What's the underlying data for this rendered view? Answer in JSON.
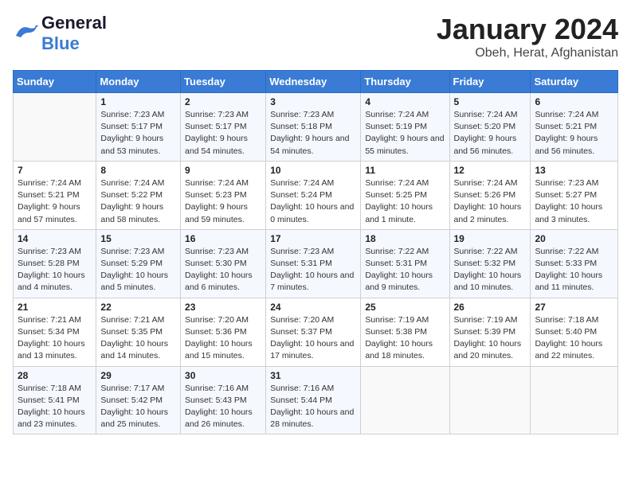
{
  "header": {
    "logo_general": "General",
    "logo_blue": "Blue",
    "title": "January 2024",
    "subtitle": "Obeh, Herat, Afghanistan"
  },
  "calendar": {
    "days_of_week": [
      "Sunday",
      "Monday",
      "Tuesday",
      "Wednesday",
      "Thursday",
      "Friday",
      "Saturday"
    ],
    "weeks": [
      [
        {
          "day": "",
          "sunrise": "",
          "sunset": "",
          "daylight": ""
        },
        {
          "day": "1",
          "sunrise": "Sunrise: 7:23 AM",
          "sunset": "Sunset: 5:17 PM",
          "daylight": "Daylight: 9 hours and 53 minutes."
        },
        {
          "day": "2",
          "sunrise": "Sunrise: 7:23 AM",
          "sunset": "Sunset: 5:17 PM",
          "daylight": "Daylight: 9 hours and 54 minutes."
        },
        {
          "day": "3",
          "sunrise": "Sunrise: 7:23 AM",
          "sunset": "Sunset: 5:18 PM",
          "daylight": "Daylight: 9 hours and 54 minutes."
        },
        {
          "day": "4",
          "sunrise": "Sunrise: 7:24 AM",
          "sunset": "Sunset: 5:19 PM",
          "daylight": "Daylight: 9 hours and 55 minutes."
        },
        {
          "day": "5",
          "sunrise": "Sunrise: 7:24 AM",
          "sunset": "Sunset: 5:20 PM",
          "daylight": "Daylight: 9 hours and 56 minutes."
        },
        {
          "day": "6",
          "sunrise": "Sunrise: 7:24 AM",
          "sunset": "Sunset: 5:21 PM",
          "daylight": "Daylight: 9 hours and 56 minutes."
        }
      ],
      [
        {
          "day": "7",
          "sunrise": "Sunrise: 7:24 AM",
          "sunset": "Sunset: 5:21 PM",
          "daylight": "Daylight: 9 hours and 57 minutes."
        },
        {
          "day": "8",
          "sunrise": "Sunrise: 7:24 AM",
          "sunset": "Sunset: 5:22 PM",
          "daylight": "Daylight: 9 hours and 58 minutes."
        },
        {
          "day": "9",
          "sunrise": "Sunrise: 7:24 AM",
          "sunset": "Sunset: 5:23 PM",
          "daylight": "Daylight: 9 hours and 59 minutes."
        },
        {
          "day": "10",
          "sunrise": "Sunrise: 7:24 AM",
          "sunset": "Sunset: 5:24 PM",
          "daylight": "Daylight: 10 hours and 0 minutes."
        },
        {
          "day": "11",
          "sunrise": "Sunrise: 7:24 AM",
          "sunset": "Sunset: 5:25 PM",
          "daylight": "Daylight: 10 hours and 1 minute."
        },
        {
          "day": "12",
          "sunrise": "Sunrise: 7:24 AM",
          "sunset": "Sunset: 5:26 PM",
          "daylight": "Daylight: 10 hours and 2 minutes."
        },
        {
          "day": "13",
          "sunrise": "Sunrise: 7:23 AM",
          "sunset": "Sunset: 5:27 PM",
          "daylight": "Daylight: 10 hours and 3 minutes."
        }
      ],
      [
        {
          "day": "14",
          "sunrise": "Sunrise: 7:23 AM",
          "sunset": "Sunset: 5:28 PM",
          "daylight": "Daylight: 10 hours and 4 minutes."
        },
        {
          "day": "15",
          "sunrise": "Sunrise: 7:23 AM",
          "sunset": "Sunset: 5:29 PM",
          "daylight": "Daylight: 10 hours and 5 minutes."
        },
        {
          "day": "16",
          "sunrise": "Sunrise: 7:23 AM",
          "sunset": "Sunset: 5:30 PM",
          "daylight": "Daylight: 10 hours and 6 minutes."
        },
        {
          "day": "17",
          "sunrise": "Sunrise: 7:23 AM",
          "sunset": "Sunset: 5:31 PM",
          "daylight": "Daylight: 10 hours and 7 minutes."
        },
        {
          "day": "18",
          "sunrise": "Sunrise: 7:22 AM",
          "sunset": "Sunset: 5:31 PM",
          "daylight": "Daylight: 10 hours and 9 minutes."
        },
        {
          "day": "19",
          "sunrise": "Sunrise: 7:22 AM",
          "sunset": "Sunset: 5:32 PM",
          "daylight": "Daylight: 10 hours and 10 minutes."
        },
        {
          "day": "20",
          "sunrise": "Sunrise: 7:22 AM",
          "sunset": "Sunset: 5:33 PM",
          "daylight": "Daylight: 10 hours and 11 minutes."
        }
      ],
      [
        {
          "day": "21",
          "sunrise": "Sunrise: 7:21 AM",
          "sunset": "Sunset: 5:34 PM",
          "daylight": "Daylight: 10 hours and 13 minutes."
        },
        {
          "day": "22",
          "sunrise": "Sunrise: 7:21 AM",
          "sunset": "Sunset: 5:35 PM",
          "daylight": "Daylight: 10 hours and 14 minutes."
        },
        {
          "day": "23",
          "sunrise": "Sunrise: 7:20 AM",
          "sunset": "Sunset: 5:36 PM",
          "daylight": "Daylight: 10 hours and 15 minutes."
        },
        {
          "day": "24",
          "sunrise": "Sunrise: 7:20 AM",
          "sunset": "Sunset: 5:37 PM",
          "daylight": "Daylight: 10 hours and 17 minutes."
        },
        {
          "day": "25",
          "sunrise": "Sunrise: 7:19 AM",
          "sunset": "Sunset: 5:38 PM",
          "daylight": "Daylight: 10 hours and 18 minutes."
        },
        {
          "day": "26",
          "sunrise": "Sunrise: 7:19 AM",
          "sunset": "Sunset: 5:39 PM",
          "daylight": "Daylight: 10 hours and 20 minutes."
        },
        {
          "day": "27",
          "sunrise": "Sunrise: 7:18 AM",
          "sunset": "Sunset: 5:40 PM",
          "daylight": "Daylight: 10 hours and 22 minutes."
        }
      ],
      [
        {
          "day": "28",
          "sunrise": "Sunrise: 7:18 AM",
          "sunset": "Sunset: 5:41 PM",
          "daylight": "Daylight: 10 hours and 23 minutes."
        },
        {
          "day": "29",
          "sunrise": "Sunrise: 7:17 AM",
          "sunset": "Sunset: 5:42 PM",
          "daylight": "Daylight: 10 hours and 25 minutes."
        },
        {
          "day": "30",
          "sunrise": "Sunrise: 7:16 AM",
          "sunset": "Sunset: 5:43 PM",
          "daylight": "Daylight: 10 hours and 26 minutes."
        },
        {
          "day": "31",
          "sunrise": "Sunrise: 7:16 AM",
          "sunset": "Sunset: 5:44 PM",
          "daylight": "Daylight: 10 hours and 28 minutes."
        },
        {
          "day": "",
          "sunrise": "",
          "sunset": "",
          "daylight": ""
        },
        {
          "day": "",
          "sunrise": "",
          "sunset": "",
          "daylight": ""
        },
        {
          "day": "",
          "sunrise": "",
          "sunset": "",
          "daylight": ""
        }
      ]
    ]
  }
}
